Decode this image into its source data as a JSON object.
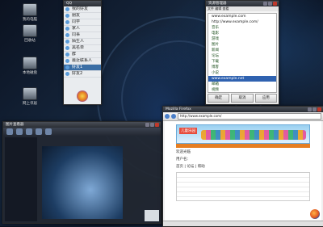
{
  "desktop": {
    "icons": [
      {
        "name": "desktop-icon-computer",
        "label": "我的电脑"
      },
      {
        "name": "desktop-icon-recycle",
        "label": "回收站"
      },
      {
        "name": "desktop-icon-drive",
        "label": "本地磁盘"
      },
      {
        "name": "desktop-icon-drive-2",
        "label": "网上邻居"
      }
    ]
  },
  "qq_window": {
    "title": "QQ",
    "contacts": [
      "我的好友",
      "朋友",
      "同学",
      "家人",
      "同事",
      "陌生人",
      "黑名单",
      "群",
      "最近联系人",
      "好友1",
      "好友2"
    ]
  },
  "tree_window": {
    "title": "资源管理器",
    "menu": "文件 编辑 查看",
    "items": [
      {
        "label": "www.example.com",
        "type": "folder"
      },
      {
        "label": "http://www.example.com/",
        "type": "folder"
      },
      {
        "label": "音乐",
        "type": "item"
      },
      {
        "label": "电影",
        "type": "item"
      },
      {
        "label": "游戏",
        "type": "item"
      },
      {
        "label": "图片",
        "type": "item"
      },
      {
        "label": "新闻",
        "type": "item"
      },
      {
        "label": "论坛",
        "type": "item"
      },
      {
        "label": "下载",
        "type": "item"
      },
      {
        "label": "博客",
        "type": "item"
      },
      {
        "label": "小说",
        "type": "item"
      },
      {
        "label": "www.example.net",
        "type": "selected"
      },
      {
        "label": "邮箱",
        "type": "item"
      },
      {
        "label": "视频",
        "type": "item"
      }
    ],
    "buttons": [
      "确定",
      "取消",
      "应用"
    ]
  },
  "viewer_window": {
    "title": "图片查看器"
  },
  "browser_window": {
    "title": "Mozilla Firefox",
    "url": "http://www.example.com/",
    "banner_logo": "儿童乐园",
    "line1": "欢迎光临",
    "line2": "用户名：",
    "line3": "首页 | 论坛 | 帮助"
  }
}
